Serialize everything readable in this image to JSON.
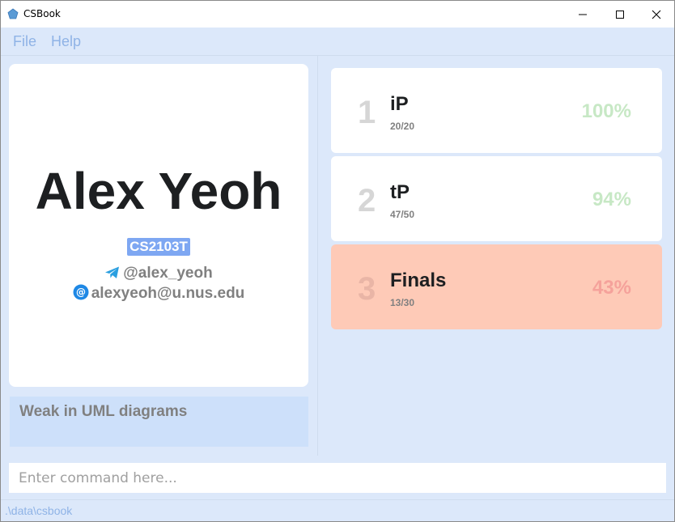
{
  "window": {
    "title": "CSBook",
    "icon": "pentagon-app-icon"
  },
  "menu": {
    "file": "File",
    "help": "Help"
  },
  "profile": {
    "name": "Alex Yeoh",
    "tag": "CS2103T",
    "telegram": "@alex_yeoh",
    "email": "alexyeoh@u.nus.edu",
    "note": "Weak in UML diagrams"
  },
  "assessments": [
    {
      "index": "1",
      "name": "iP",
      "score": "20/20",
      "percent": "100%",
      "status": "good"
    },
    {
      "index": "2",
      "name": "tP",
      "score": "47/50",
      "percent": "94%",
      "status": "good"
    },
    {
      "index": "3",
      "name": "Finals",
      "score": "13/30",
      "percent": "43%",
      "status": "bad"
    }
  ],
  "command": {
    "placeholder": "Enter command here...",
    "value": ""
  },
  "status": {
    "path": ".\\data\\csbook"
  },
  "colors": {
    "accent_tag": "#7ea7f2",
    "good_percent": "#c7e8c5",
    "bad_card": "#fecab7",
    "bad_percent": "#f5a29b",
    "background": "#dce8fa"
  }
}
